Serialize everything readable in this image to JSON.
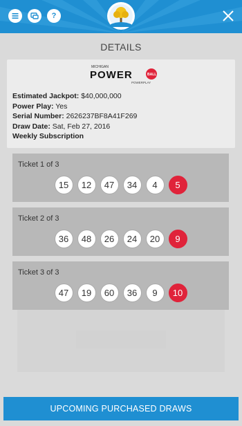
{
  "header": {
    "icons": [
      "menu-icon",
      "chat-icon",
      "help-icon"
    ],
    "help_glyph": "?",
    "close_icon": "close-icon",
    "logo_icon": "lottery-tree-logo"
  },
  "details": {
    "title": "DETAILS",
    "logo": {
      "state_text": "MICHIGAN",
      "brand_text": "POWER",
      "ball_text": "BALL",
      "sub_text": "POWERPLAY"
    },
    "rows": [
      {
        "label": "Estimated Jackpot:",
        "value": " $40,000,000"
      },
      {
        "label": "Power Play:",
        "value": " Yes"
      },
      {
        "label": "Serial Number:",
        "value": " 2626237BF8A41F269"
      },
      {
        "label": "Draw Date:",
        "value": " Sat, Feb 27, 2016"
      },
      {
        "label": "Weekly Subscription",
        "value": ""
      }
    ]
  },
  "tickets": [
    {
      "label": "Ticket 1 of 3",
      "numbers": [
        "15",
        "12",
        "47",
        "34",
        "4"
      ],
      "powerball": "5"
    },
    {
      "label": "Ticket 2 of 3",
      "numbers": [
        "36",
        "48",
        "26",
        "24",
        "20"
      ],
      "powerball": "9"
    },
    {
      "label": "Ticket 3 of 3",
      "numbers": [
        "47",
        "19",
        "60",
        "36",
        "9"
      ],
      "powerball": "10"
    }
  ],
  "footer": {
    "button_label": "UPCOMING PURCHASED DRAWS"
  },
  "colors": {
    "header_blue": "#1f8fd2",
    "powerball_red": "#e0233a"
  }
}
